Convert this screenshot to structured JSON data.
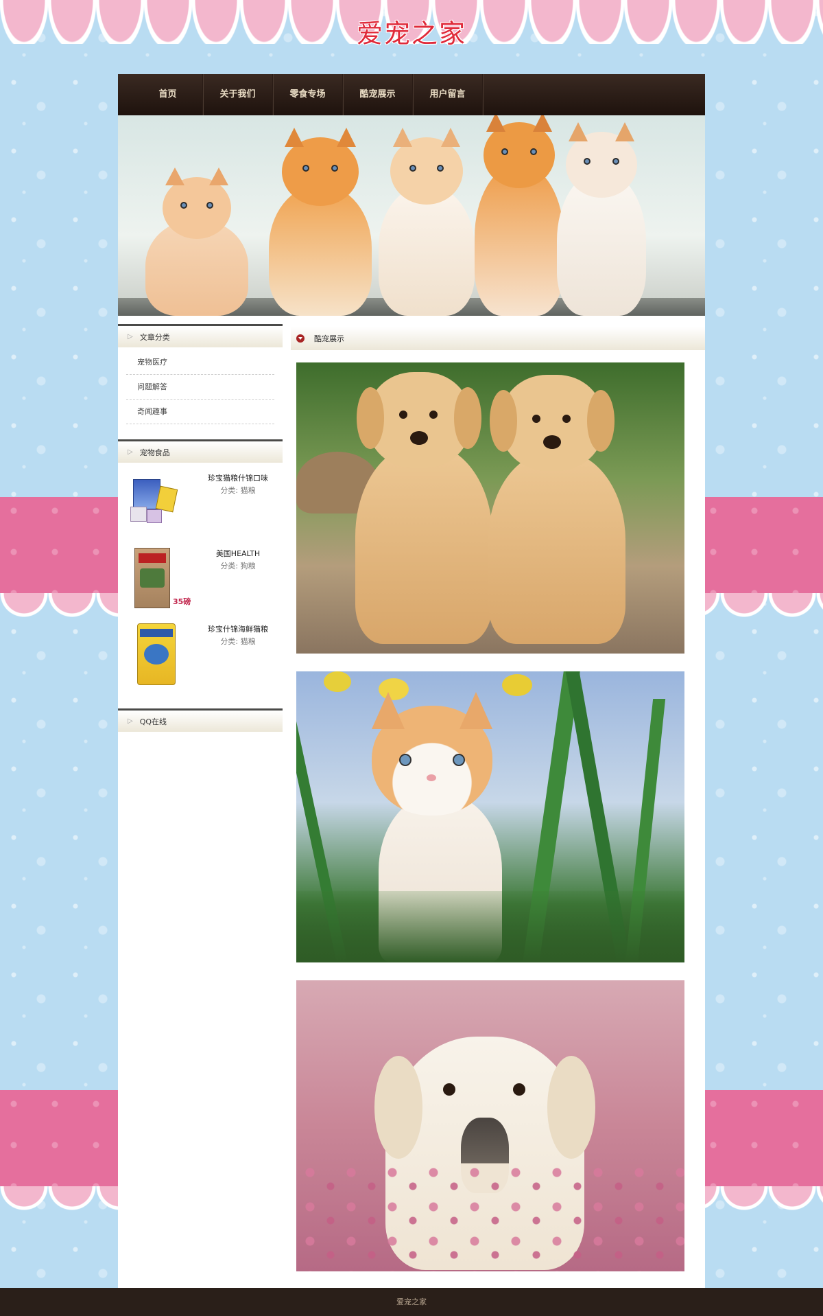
{
  "site": {
    "logo_text": "爱宠之家",
    "footer_text": "爱宠之家"
  },
  "nav": {
    "items": [
      {
        "label": "首页"
      },
      {
        "label": "关于我们"
      },
      {
        "label": "零食专场"
      },
      {
        "label": "酷宠展示"
      },
      {
        "label": "用户留言"
      }
    ]
  },
  "sidebar": {
    "categories_title": "文章分类",
    "categories": [
      {
        "label": "宠物医疗"
      },
      {
        "label": "问题解答"
      },
      {
        "label": "奇闻趣事"
      }
    ],
    "food_title": "宠物食品",
    "foods": [
      {
        "name": "珍宝猫粮什锦口味",
        "category": "分类: 猫粮",
        "badge": ""
      },
      {
        "name": "美国HEALTH",
        "category": "分类: 狗粮",
        "badge": "35磅"
      },
      {
        "name": "珍宝什锦海鲜猫粮",
        "category": "分类: 猫粮",
        "badge": ""
      }
    ],
    "qq_title": "QQ在线"
  },
  "main": {
    "section_title": "酷宠展示",
    "photos": [
      {
        "icon": "puppies-photo"
      },
      {
        "icon": "kitten-photo"
      },
      {
        "icon": "dog-photo"
      }
    ]
  },
  "colors": {
    "nav_bg": "#2a1c16",
    "nav_text": "#e9dcc4",
    "logo": "#e02a3a",
    "awning_pink": "#e56f9d",
    "bg_blue": "#b9dcf2"
  }
}
